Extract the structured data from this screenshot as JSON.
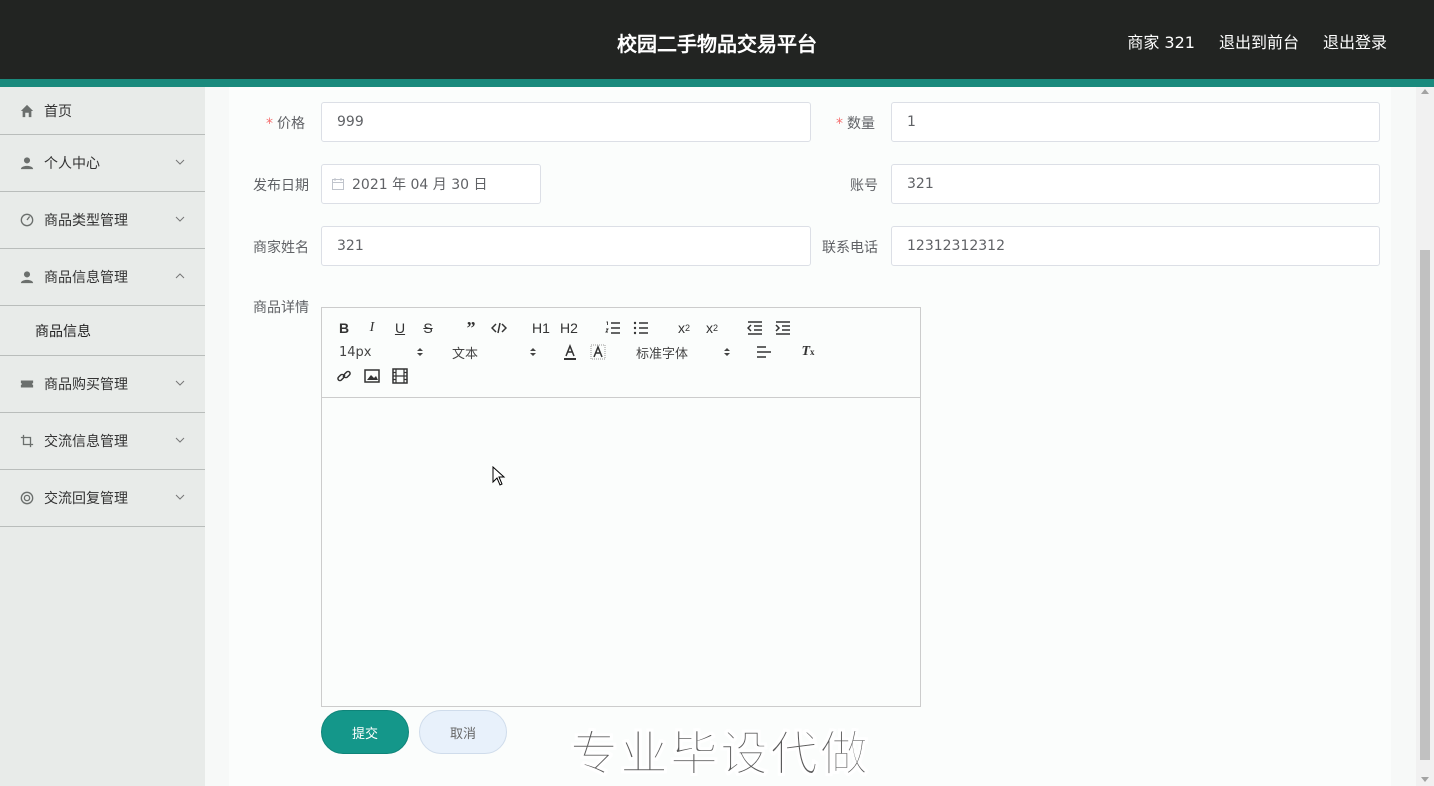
{
  "header": {
    "title": "校园二手物品交易平台",
    "user_label": "商家 321",
    "to_front_label": "退出到前台",
    "logout_label": "退出登录"
  },
  "sidebar": {
    "items": [
      {
        "label": "首页",
        "icon": "home-icon"
      },
      {
        "label": "个人中心",
        "icon": "user-icon"
      },
      {
        "label": "商品类型管理",
        "icon": "dashboard-icon"
      },
      {
        "label": "商品信息管理",
        "icon": "user-icon"
      },
      {
        "label": "商品购买管理",
        "icon": "ticket-icon"
      },
      {
        "label": "交流信息管理",
        "icon": "crop-icon"
      },
      {
        "label": "交流回复管理",
        "icon": "lifebuoy-icon"
      }
    ],
    "sub_item": "商品信息"
  },
  "form": {
    "price_label": "价格",
    "price_value": "999",
    "qty_label": "数量",
    "qty_value": "1",
    "date_label": "发布日期",
    "date_value": "2021 年 04 月 30 日",
    "account_label": "账号",
    "account_value": "321",
    "merchant_label": "商家姓名",
    "merchant_value": "321",
    "phone_label": "联系电话",
    "phone_value": "12312312312",
    "detail_label": "商品详情",
    "required_mark": "*"
  },
  "editor": {
    "font_size": "14px",
    "heading": "文本",
    "font_family": "标准字体",
    "h1": "H1",
    "h2": "H2"
  },
  "buttons": {
    "submit": "提交",
    "cancel": "取消"
  },
  "watermark": "专业毕设代做",
  "colors": {
    "header_bg": "#222422",
    "accent": "#14978a",
    "sidebar_bg": "#e8ebe9"
  }
}
